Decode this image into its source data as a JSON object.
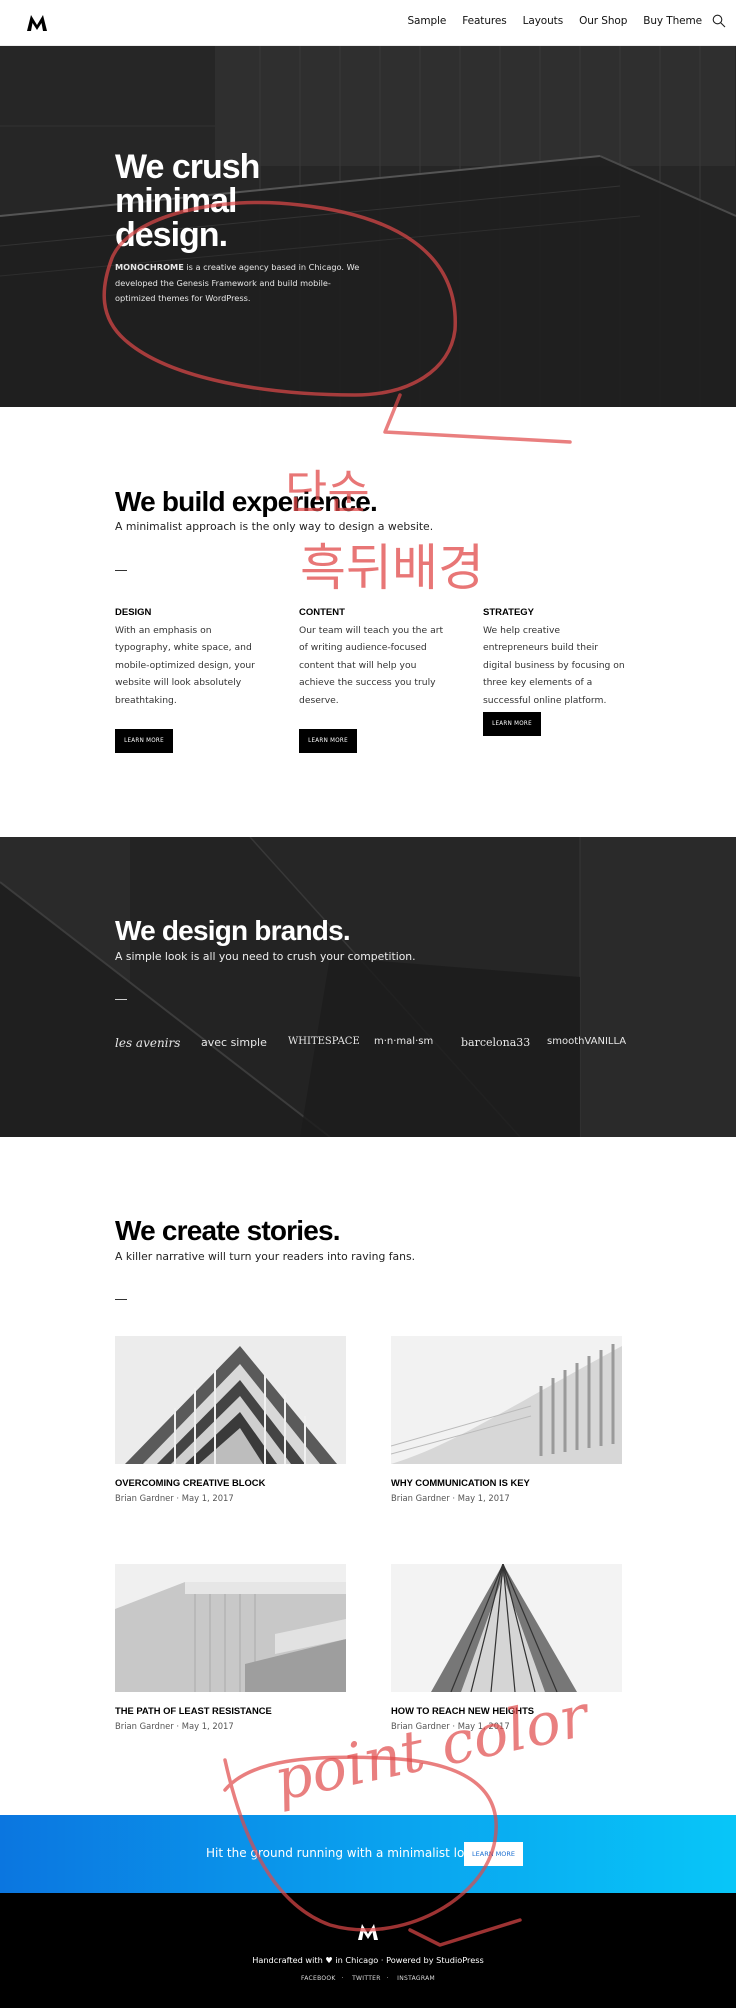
{
  "header": {
    "nav": [
      "Sample",
      "Features",
      "Layouts",
      "Our Shop",
      "Buy Theme"
    ]
  },
  "hero": {
    "title_lines": [
      "We crush",
      "minimal",
      "design."
    ],
    "brand": "MONOCHROME",
    "text": " is a creative agency based in Chicago. We developed the Genesis Framework and build mobile-optimized themes for WordPress."
  },
  "experience": {
    "title": "We build experience.",
    "subtitle": "A minimalist approach is the only way to design a website.",
    "columns": [
      {
        "heading": "DESIGN",
        "text": "With an emphasis on typography, white space, and mobile-optimized design, your website will look absolutely breathtaking.",
        "button": "LEARN MORE"
      },
      {
        "heading": "CONTENT",
        "text": "Our team will teach you the art of writing audience-focused content that will help you achieve the success you truly deserve.",
        "button": "LEARN MORE"
      },
      {
        "heading": "STRATEGY",
        "text": "We help creative entrepreneurs build their digital business by focusing on three key elements of a successful online platform.",
        "button": "LEARN MORE"
      }
    ]
  },
  "brands": {
    "title": "We design brands.",
    "subtitle": "A simple look is all you need to crush your competition.",
    "logos": [
      "les avenirs",
      "avec simple",
      "WHITESPACE",
      "m·n·mal·sm",
      "barcelona33",
      "smoothVANILLA"
    ]
  },
  "stories": {
    "title": "We create stories.",
    "subtitle": "A killer narrative will turn your readers into raving fans.",
    "posts": [
      {
        "title": "OVERCOMING CREATIVE BLOCK",
        "meta": "Brian Gardner · May 1, 2017"
      },
      {
        "title": "WHY COMMUNICATION IS KEY",
        "meta": "Brian Gardner · May 1, 2017"
      },
      {
        "title": "THE PATH OF LEAST RESISTANCE",
        "meta": "Brian Gardner · May 1, 2017"
      },
      {
        "title": "HOW TO REACH NEW HEIGHTS",
        "meta": "Brian Gardner · May 1, 2017"
      }
    ]
  },
  "cta": {
    "text": "Hit the ground running with a minimalist look.",
    "button": "LEARN MORE"
  },
  "footer": {
    "credit": "Handcrafted with ♥ in Chicago · Powered by StudioPress",
    "links": [
      "FACEBOOK",
      "TWITTER",
      "INSTAGRAM"
    ]
  },
  "annotations": {
    "text1": "단순",
    "text2": "흑뒤배경",
    "text3": "point color"
  },
  "colors": {
    "accent_gradient_start": "#0b76e0",
    "accent_gradient_end": "#08c6f8",
    "annotation": "#e04848",
    "dark_bg": "#262626"
  }
}
